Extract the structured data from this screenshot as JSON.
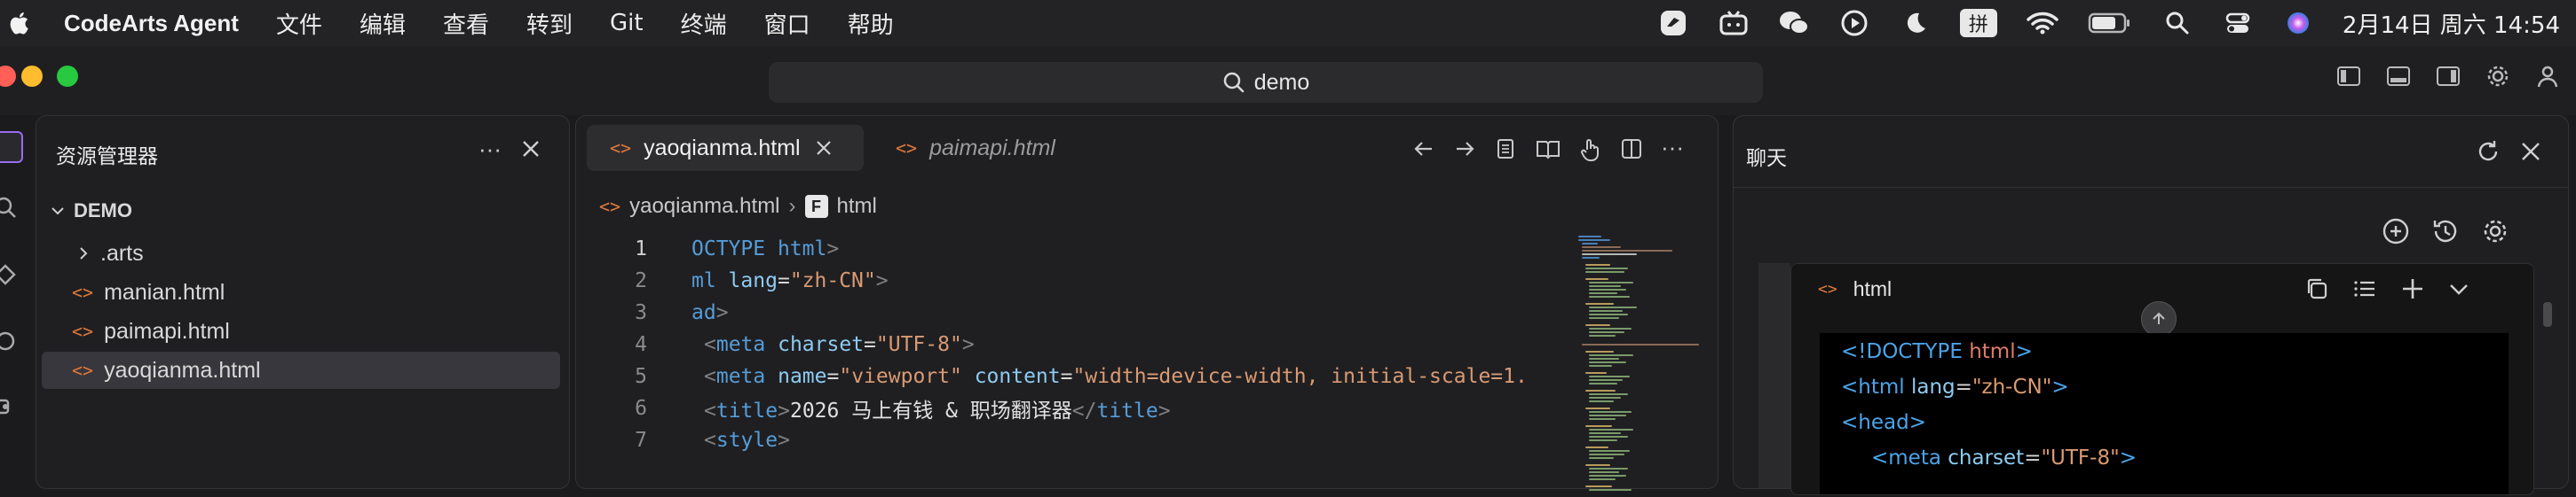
{
  "menubar": {
    "app_name": "CodeArts Agent",
    "menus": [
      "文件",
      "编辑",
      "查看",
      "转到",
      "Git",
      "终端",
      "窗口",
      "帮助"
    ],
    "ime_label": "拼",
    "clock": "2月14日 周六  14:54"
  },
  "titlebar": {
    "search_text": "demo"
  },
  "explorer": {
    "title": "资源管理器",
    "folder": "DEMO",
    "items": [
      ".arts",
      "manian.html",
      "paimapi.html",
      "yaoqianma.html"
    ]
  },
  "editor": {
    "tabs": [
      {
        "label": "yaoqianma.html",
        "active": true
      },
      {
        "label": "paimapi.html",
        "active": false
      }
    ],
    "breadcrumb": {
      "file": "yaoqianma.html",
      "symbol_badge": "F",
      "symbol": "html"
    },
    "line_numbers": [
      "1",
      "2",
      "3",
      "4",
      "5",
      "6",
      "7"
    ],
    "lines": {
      "l1_a": "OCTYPE",
      "l1_b": " html",
      "l1_c": ">",
      "l2_a": "ml",
      "l2_b": " lang",
      "l2_c": "=",
      "l2_d": "\"zh-CN\"",
      "l2_e": ">",
      "l3_a": "ad",
      "l3_b": ">",
      "l4_a": "<",
      "l4_b": "meta",
      "l4_c": " charset",
      "l4_d": "=",
      "l4_e": "\"UTF-8\"",
      "l4_f": ">",
      "l5_a": "<",
      "l5_b": "meta",
      "l5_c": " name",
      "l5_d": "=",
      "l5_e": "\"viewport\"",
      "l5_f": " content",
      "l5_g": "=",
      "l5_h": "\"width=device-width, initial-scale=1.",
      "l6_a": "<",
      "l6_b": "title",
      "l6_c": ">",
      "l6_d": "2026 马上有钱 & 职场翻译器",
      "l6_e": "</",
      "l6_f": "title",
      "l6_g": ">",
      "l7_a": "<",
      "l7_b": "style",
      "l7_c": ">"
    }
  },
  "chat": {
    "title": "聊天",
    "codeblock_lang": "html",
    "code": {
      "c1_a": "<!DOCTYPE ",
      "c1_b": "html",
      "c1_c": ">",
      "c2_a": "<html ",
      "c2_b": "lang",
      "c2_c": "=",
      "c2_d": "\"zh-CN\"",
      "c2_e": ">",
      "c3_a": "<head>",
      "c4_a": "<meta ",
      "c4_b": "charset",
      "c4_c": "=",
      "c4_d": "\"UTF-8\"",
      "c4_e": ">"
    }
  },
  "colors": {
    "accent_orange": "#e0793a",
    "selection": "#37373d"
  }
}
